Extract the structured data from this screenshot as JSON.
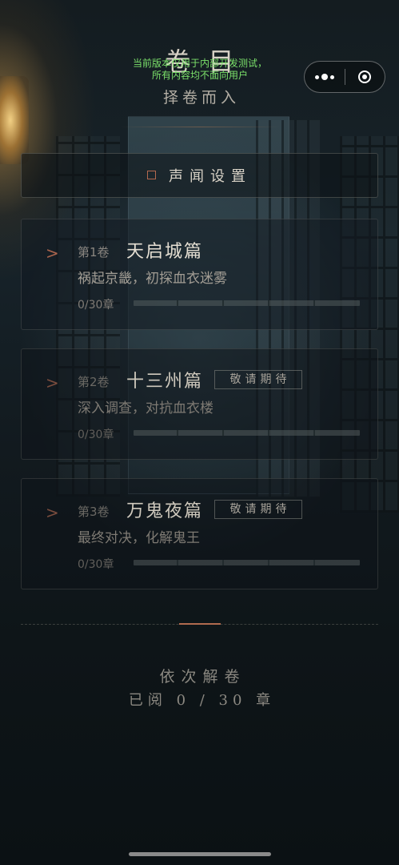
{
  "notice": {
    "line1": "当前版本仅用于内部开发测试，",
    "line2": "所有内容均不面向用户"
  },
  "header": {
    "title": "卷目",
    "subtitle": "择卷而入"
  },
  "sound": {
    "label": "声闻设置",
    "icon": "square-outline-icon"
  },
  "volumes": [
    {
      "number": "第1卷",
      "name": "天启城篇",
      "desc": "祸起京畿，初探血衣迷雾",
      "progress": "0/30章",
      "progress_value": 0,
      "tag": "",
      "locked": false
    },
    {
      "number": "第2卷",
      "name": "十三州篇",
      "desc": "深入调查，对抗血衣楼",
      "progress": "0/30章",
      "progress_value": 0,
      "tag": "敬请期待",
      "locked": true
    },
    {
      "number": "第3卷",
      "name": "万鬼夜篇",
      "desc": "最终对决，化解鬼王",
      "progress": "0/30章",
      "progress_value": 0,
      "tag": "敬请期待",
      "locked": true
    }
  ],
  "footer": {
    "title": "依次解卷",
    "progress": "已阅 0 / 30 章"
  },
  "colors": {
    "accent": "#b4694f",
    "notice": "#7be06a",
    "background": "#0d1418"
  }
}
